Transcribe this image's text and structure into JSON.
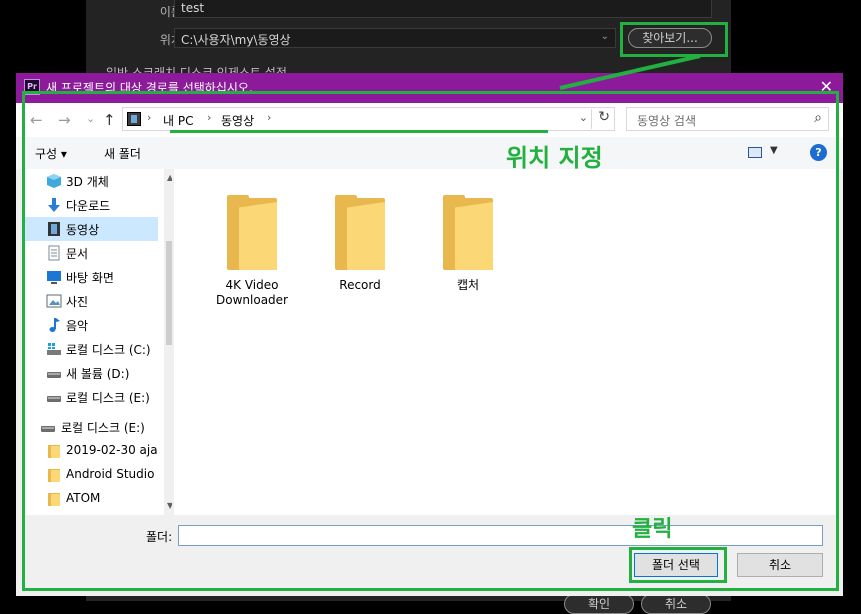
{
  "background": {
    "name_label": "이름:",
    "name_value": "test",
    "location_label": "위치:",
    "location_value": "C:\\사용자\\my\\동영상",
    "browse_button": "찾아보기...",
    "tabs_text": "일반     스크래치 디스크     인제스트 설정",
    "ok_button": "확인",
    "cancel_button": "취소"
  },
  "dialog": {
    "title": "새 프로젝트의 대상 경로를 선택하십시오.",
    "nav": {
      "back": "←",
      "forward": "→",
      "recent": "⌄",
      "up": "↑"
    },
    "address": {
      "segments": [
        "내 PC",
        "동영상"
      ],
      "separator": "›"
    },
    "search_placeholder": "동영상 검색",
    "toolbar": {
      "organize": "구성 ▾",
      "new_folder": "새 폴더"
    },
    "nav_pane": {
      "items": [
        {
          "label": "3D 개체",
          "icon": "3d-objects-icon"
        },
        {
          "label": "다운로드",
          "icon": "download-icon"
        },
        {
          "label": "동영상",
          "icon": "video-icon",
          "selected": true
        },
        {
          "label": "문서",
          "icon": "document-icon"
        },
        {
          "label": "바탕 화면",
          "icon": "desktop-icon"
        },
        {
          "label": "사진",
          "icon": "pictures-icon"
        },
        {
          "label": "음악",
          "icon": "music-icon"
        },
        {
          "label": "로컬 디스크 (C:)",
          "icon": "system-drive-icon"
        },
        {
          "label": "새 볼륨 (D:)",
          "icon": "drive-icon"
        },
        {
          "label": "로컬 디스크 (E:)",
          "icon": "drive-icon"
        },
        {
          "label": "로컬 디스크 (E:)",
          "icon": "drive-icon"
        },
        {
          "label": "2019-02-30 aja",
          "icon": "folder-icon"
        },
        {
          "label": "Android Studio",
          "icon": "folder-icon"
        },
        {
          "label": "ATOM",
          "icon": "folder-icon"
        }
      ]
    },
    "folders": [
      {
        "line1": "4K Video",
        "line2": "Downloader"
      },
      {
        "line1": "Record",
        "line2": ""
      },
      {
        "line1": "캡처",
        "line2": ""
      }
    ],
    "folder_label": "폴더:",
    "folder_value": "",
    "select_button": "폴더 선택",
    "cancel_button": "취소"
  },
  "annotations": {
    "location_text": "위치 지정",
    "click_text": "클릭",
    "color": "#22b040"
  },
  "colors": {
    "titlebar": "#8d1a9b",
    "selection": "#cce8ff",
    "folder": "#fbd775"
  }
}
